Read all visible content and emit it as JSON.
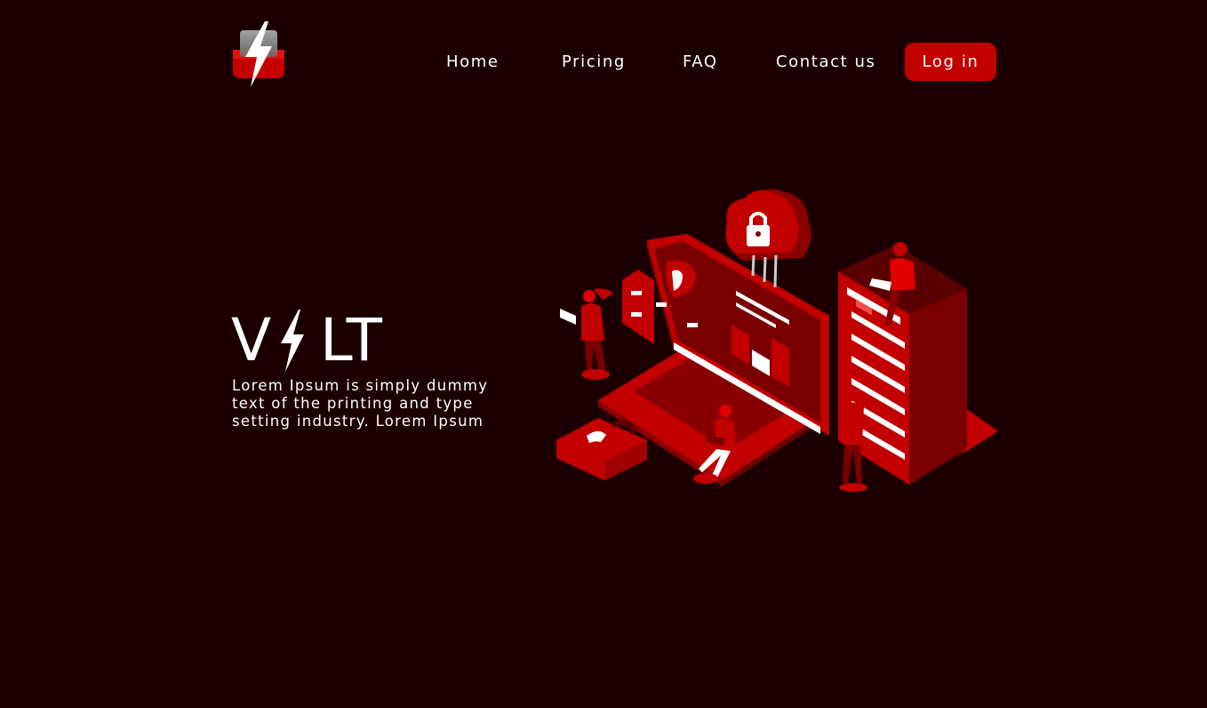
{
  "header": {
    "logo_icon": "lightning-bolt-shield-logo",
    "nav": {
      "home": "Home",
      "pricing": "Pricing",
      "faq": "FAQ",
      "contact": "Contact us"
    },
    "login_label": "Log in"
  },
  "hero": {
    "brand_first": "V",
    "brand_rest": "LT",
    "brand_icon": "lightning-bolt-icon",
    "tagline_lines": [
      "Lorem Ipsum is simply dummy",
      "text of the printing and type",
      "setting industry. Lorem Ipsum"
    ],
    "illustration_icon": "cyber-security-isometric-illustration"
  },
  "colors": {
    "background": "#1c0001",
    "accent": "#c20000",
    "dark_red": "#7a0000",
    "text": "#ffffff"
  }
}
